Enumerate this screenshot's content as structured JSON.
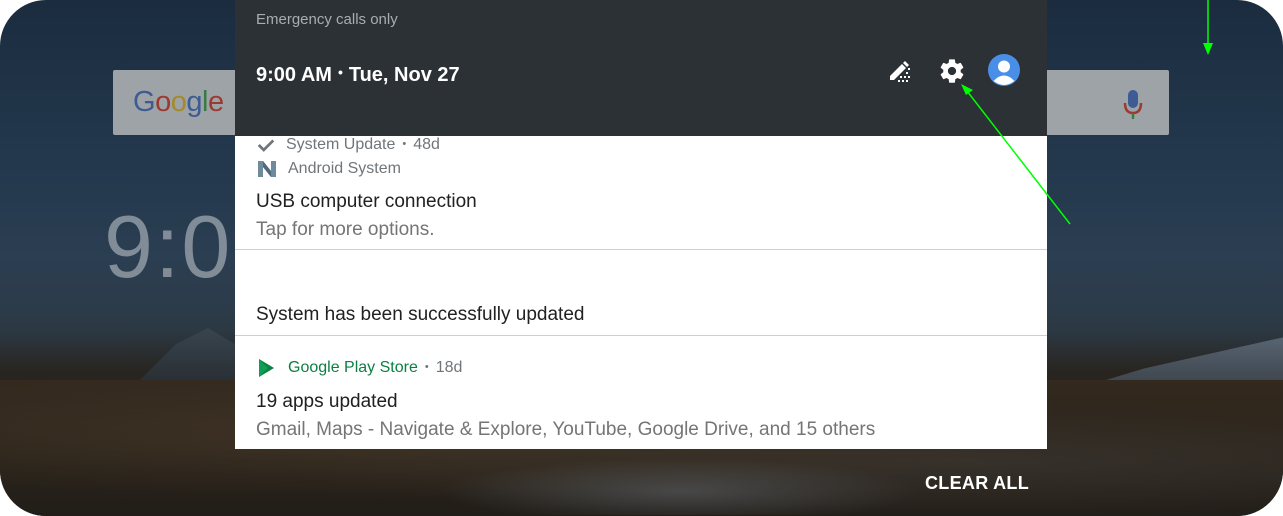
{
  "status": {
    "carrier_text": "Emergency calls only",
    "time": "9:00 AM",
    "date": "Tue, Nov 27"
  },
  "quick_settings": {
    "icons": [
      "edit-brightness-icon",
      "settings-icon",
      "user-avatar-icon"
    ]
  },
  "home": {
    "search_logo_letters": [
      "G",
      "o",
      "o",
      "g",
      "l",
      "e"
    ],
    "clock_partial": "9:0"
  },
  "notifications": [
    {
      "app": "Android System",
      "time": "",
      "title": "USB computer connection",
      "text": "Tap for more options."
    },
    {
      "app": "System Update",
      "time": "48d",
      "title": "System has been successfully updated",
      "text": ""
    },
    {
      "app": "Google Play Store",
      "time": "18d",
      "title": "19 apps updated",
      "text": "Gmail, Maps - Navigate & Explore, YouTube, Google Drive, and 15 others"
    }
  ],
  "actions": {
    "clear_all": "CLEAR ALL"
  },
  "colors": {
    "shade_header": "#2c3135",
    "play_store_green": "#0b8043",
    "annotation_arrow": "#00ff00"
  }
}
